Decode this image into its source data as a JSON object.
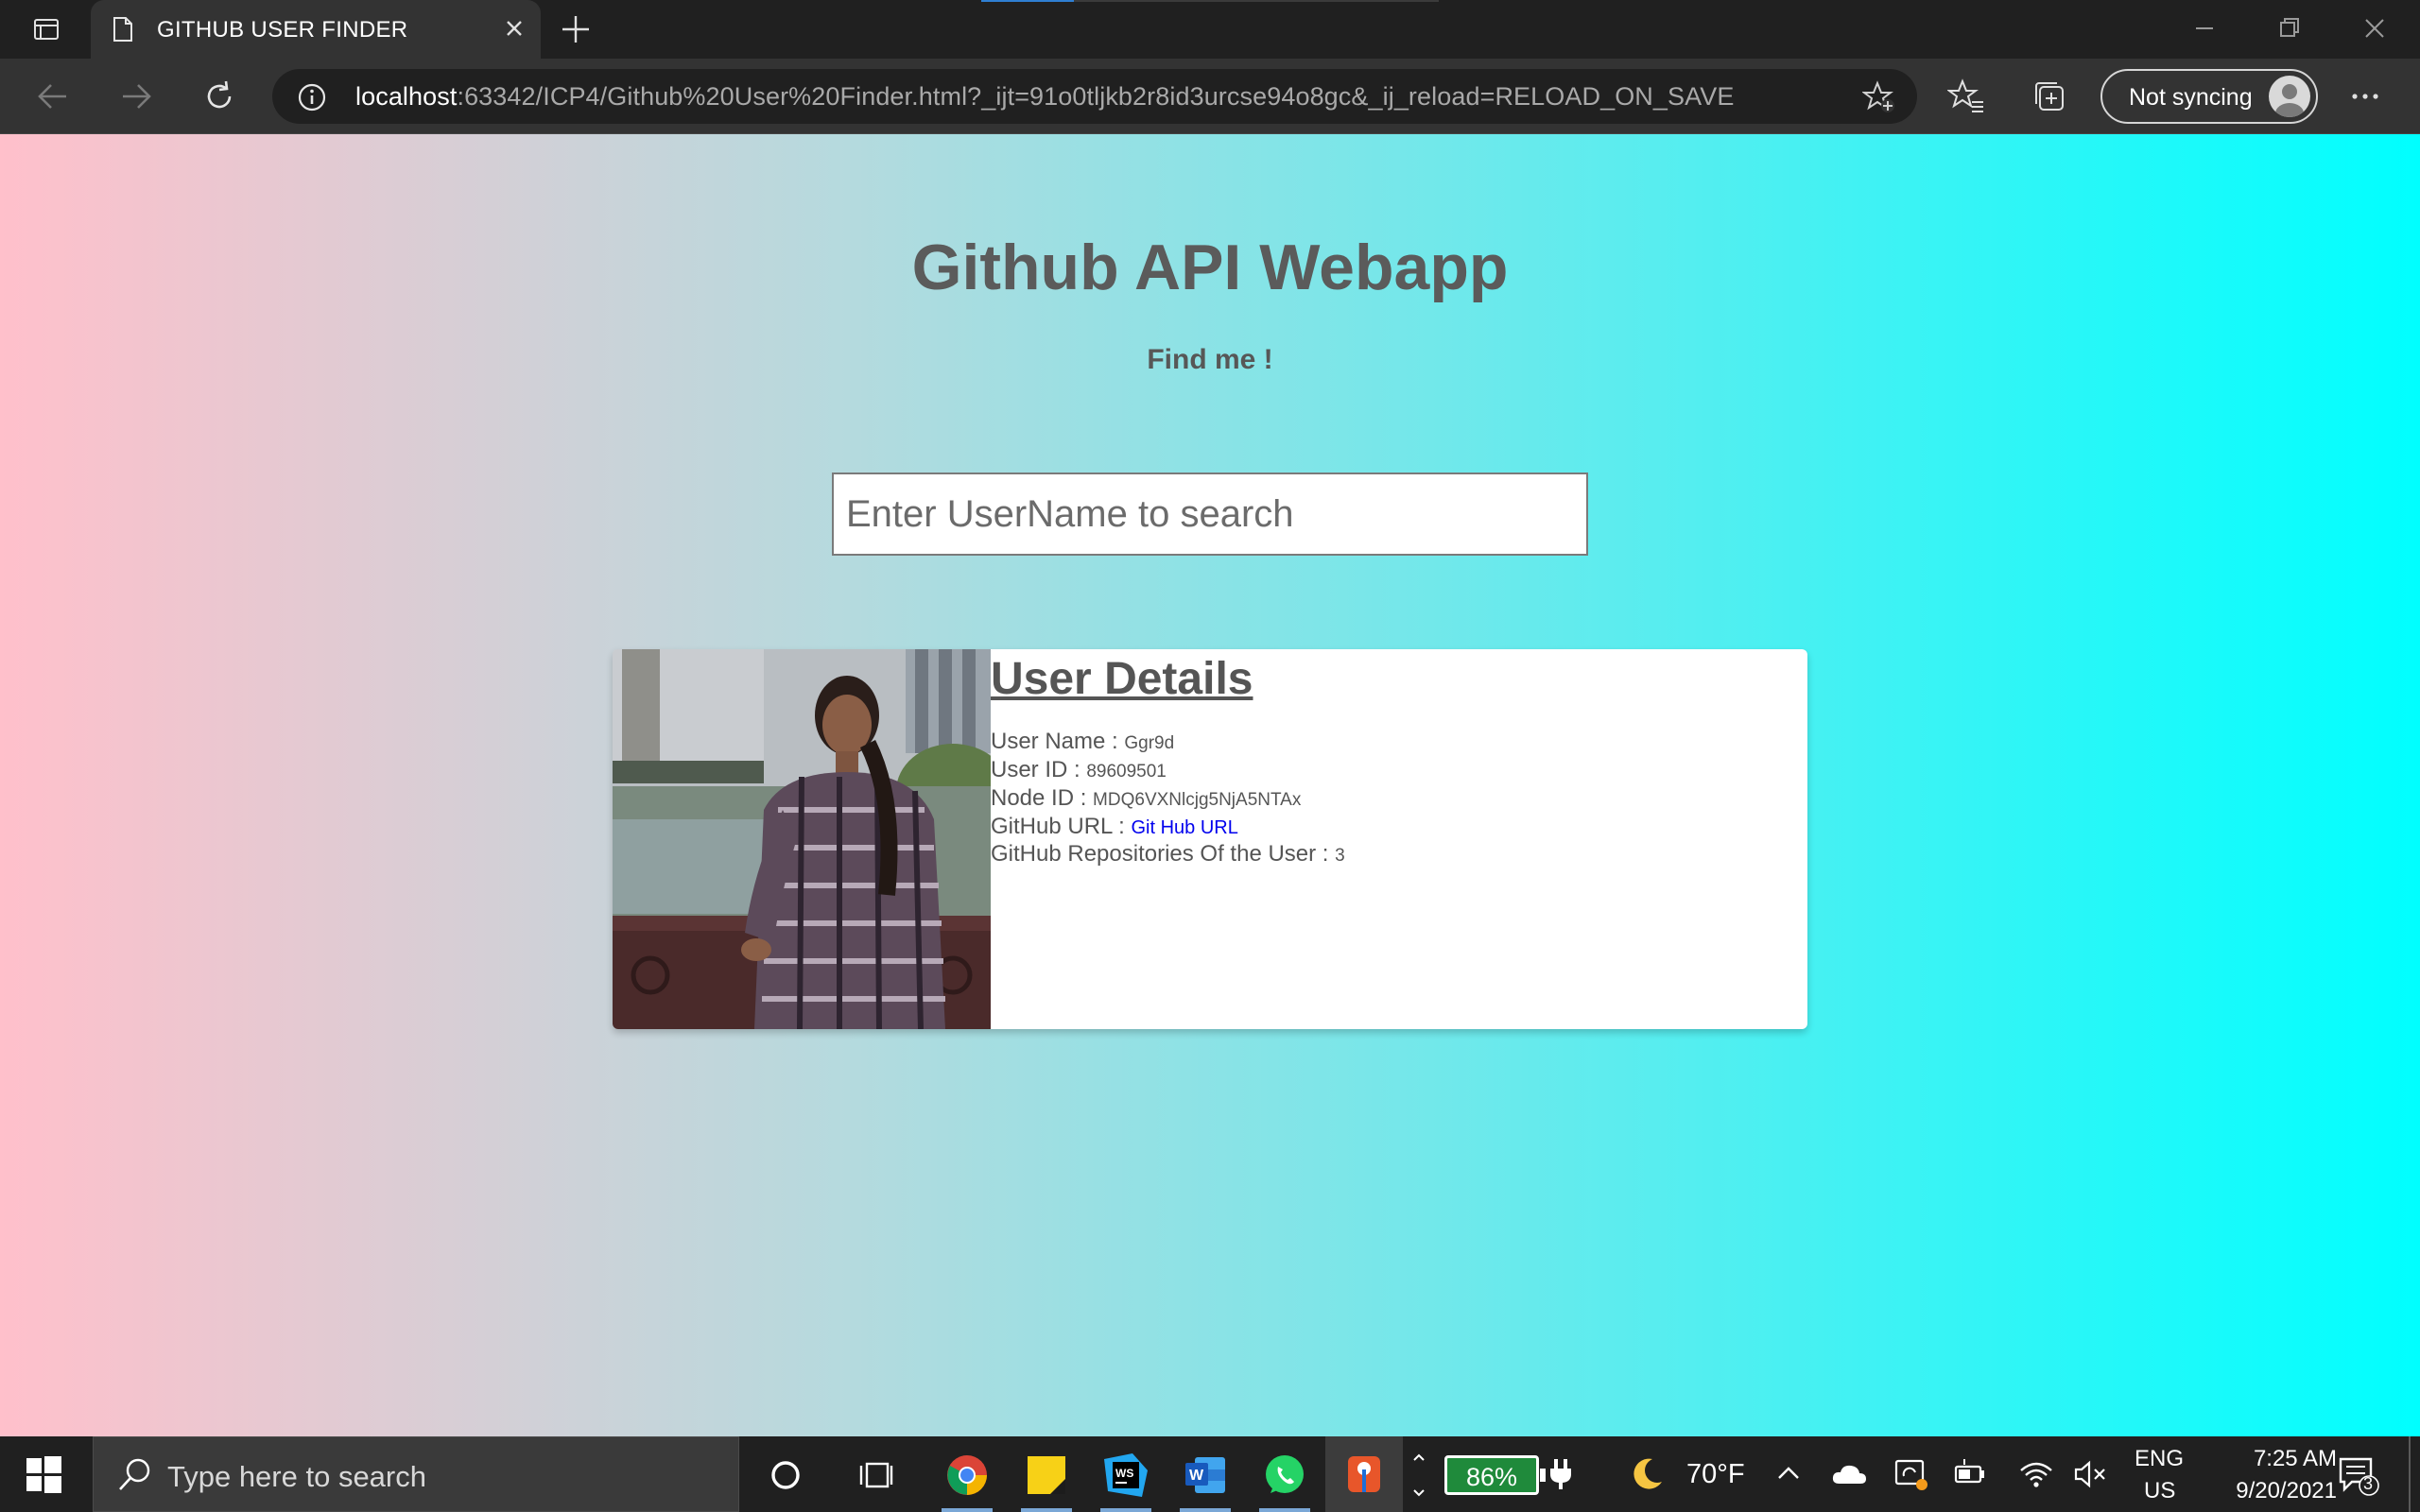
{
  "browser": {
    "tab_title": "GITHUB USER FINDER",
    "url_host": "localhost",
    "url_path": ":63342/ICP4/Github%20User%20Finder.html?_ijt=91o0tljkb2r8id3urcse94o8gc&_ij_reload=RELOAD_ON_SAVE",
    "sync_label": "Not syncing"
  },
  "page": {
    "title": "Github API Webapp",
    "subtitle": "Find me !",
    "search_placeholder": "Enter UserName to search",
    "card": {
      "heading": "User Details",
      "user_name_label": "User Name : ",
      "user_name": "Ggr9d",
      "user_id_label": "User ID : ",
      "user_id": "89609501",
      "node_id_label": "Node ID : ",
      "node_id": "MDQ6VXNlcjg5NjA5NTAx",
      "github_url_label": "GitHub URL : ",
      "github_url_link": "Git Hub URL",
      "repos_label": "GitHub Repositories Of the User : ",
      "repos": "3"
    }
  },
  "taskbar": {
    "search_placeholder": "Type here to search",
    "battery": "86%",
    "weather": "70°F",
    "lang_top": "ENG",
    "lang_bottom": "US",
    "time": "7:25 AM",
    "date": "9/20/2021",
    "notifications": "3"
  },
  "colors": {
    "gradient_start": "#ffc0cb",
    "gradient_end": "#00ffff",
    "link": "#0000ee",
    "battery_fill": "#1f8a3b"
  }
}
